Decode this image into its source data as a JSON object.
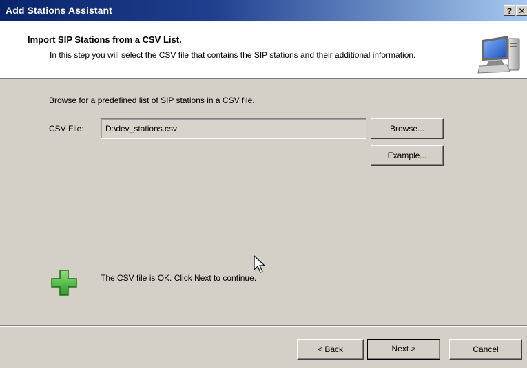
{
  "window": {
    "title": "Add Stations Assistant",
    "help_label": "?",
    "close_label": "✕"
  },
  "header": {
    "title": "Import SIP Stations from a CSV List.",
    "description": "In this step you will select the CSV file that contains the SIP stations and their additional information.",
    "icon": "computer-icon"
  },
  "body": {
    "intro": "Browse for a predefined list of SIP stations in a CSV file.",
    "csv_label": "CSV File:",
    "csv_value": "D:\\dev_stations.csv",
    "browse_label": "Browse...",
    "example_label": "Example...",
    "status_text": "The CSV file is OK.  Click Next to continue.",
    "status_icon": "green-plus-icon",
    "status_color": "#3cb043"
  },
  "footer": {
    "back_label": "< Back",
    "next_label": "Next >",
    "cancel_label": "Cancel"
  },
  "colors": {
    "title_bar": "#0a246a",
    "dialog_bg": "#d4d0c8",
    "header_bg": "#ffffff"
  }
}
